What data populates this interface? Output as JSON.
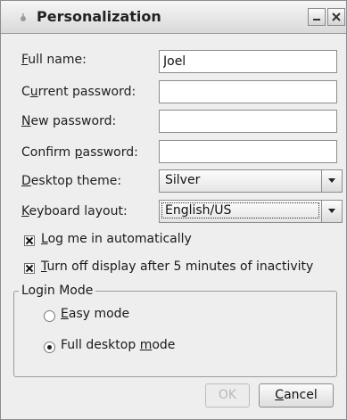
{
  "window": {
    "title": "Personalization"
  },
  "form": {
    "full_name_label_pre": "",
    "full_name_label_u": "F",
    "full_name_label_post": "ull name:",
    "full_name_value": "Joel",
    "current_password_pre": "C",
    "current_password_u": "u",
    "current_password_post": "rrent password:",
    "current_password_value": "",
    "new_password_pre": "",
    "new_password_u": "N",
    "new_password_post": "ew password:",
    "new_password_value": "",
    "confirm_password_pre": "Confirm ",
    "confirm_password_u": "p",
    "confirm_password_post": "assword:",
    "confirm_password_value": "",
    "desktop_theme_pre": "",
    "desktop_theme_u": "D",
    "desktop_theme_post": "esktop theme:",
    "desktop_theme_value": "Silver",
    "keyboard_layout_pre": "",
    "keyboard_layout_u": "K",
    "keyboard_layout_post": "eyboard layout:",
    "keyboard_layout_value": "English/US"
  },
  "options": {
    "login_auto_pre": "",
    "login_auto_u": "L",
    "login_auto_post": "og me in automatically",
    "login_auto_checked": true,
    "display_off_pre": "",
    "display_off_u": "T",
    "display_off_post": "urn off display after 5 minutes of inactivity",
    "display_off_checked": true
  },
  "login_mode": {
    "legend": "Login Mode",
    "easy_pre": "",
    "easy_u": "E",
    "easy_post": "asy mode",
    "easy_selected": false,
    "full_pre": "Full desktop ",
    "full_u": "m",
    "full_post": "ode",
    "full_selected": true
  },
  "buttons": {
    "ok_label": "OK",
    "ok_enabled": false,
    "cancel_pre": "",
    "cancel_u": "C",
    "cancel_post": "ancel"
  }
}
